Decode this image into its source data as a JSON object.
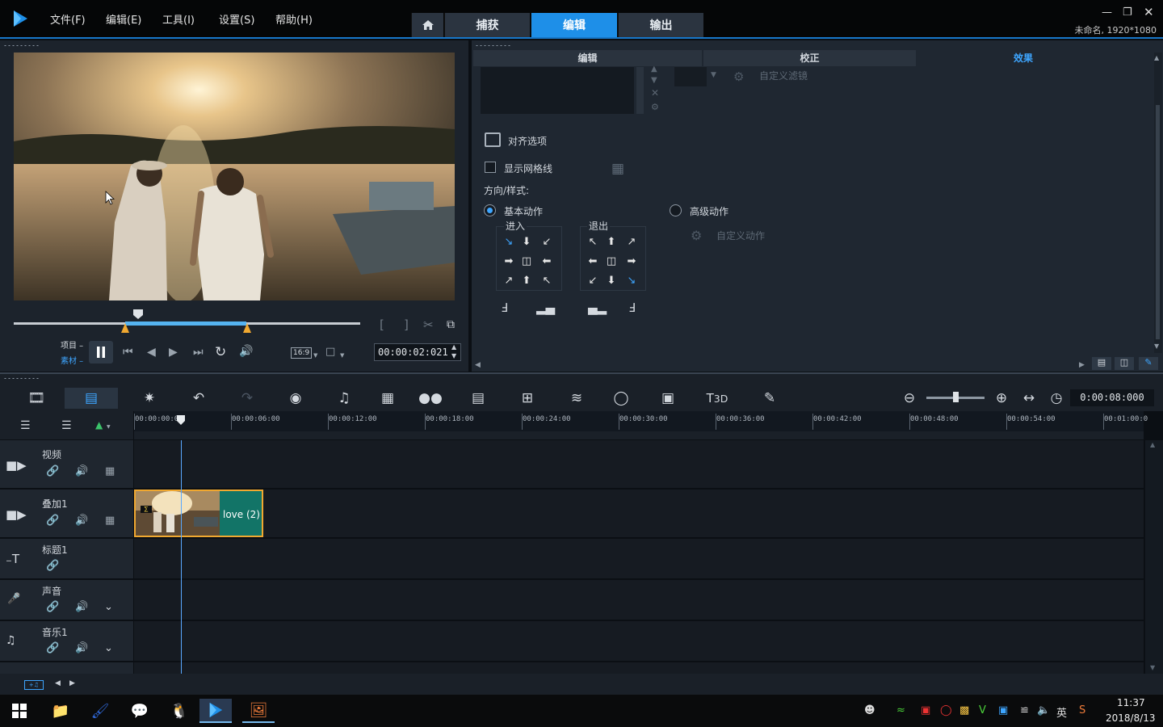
{
  "app": {
    "menu": [
      "文件(F)",
      "编辑(E)",
      "工具(I)",
      "设置(S)",
      "帮助(H)"
    ],
    "nav_tabs": [
      {
        "label": "捕获",
        "active": false
      },
      {
        "label": "编辑",
        "active": true
      },
      {
        "label": "输出",
        "active": false
      }
    ],
    "project_info": "未命名, 1920*1080",
    "accent_color": "#1e8fe8"
  },
  "preview": {
    "timecode": "00:00:02:021",
    "aspect_ratio": "16:9",
    "mode_project": "项目",
    "mode_clip": "素材",
    "slider_position": 0.28
  },
  "options_panel": {
    "tabs": [
      {
        "label": "编辑",
        "active": false
      },
      {
        "label": "校正",
        "active": false
      },
      {
        "label": "效果",
        "active": true
      }
    ],
    "custom_filter_label": "自定义滤镜",
    "alignment_options_label": "对齐选项",
    "show_grid_label": "显示网格线",
    "show_grid_checked": false,
    "direction_style_label": "方向/样式:",
    "basic_motion_label": "基本动作",
    "advanced_motion_label": "高级动作",
    "basic_motion_selected": true,
    "enter_label": "进入",
    "exit_label": "退出",
    "custom_motion_label": "自定义动作"
  },
  "timeline": {
    "duration": "0:00:08:000",
    "ruler_labels": [
      "00:00:00:00",
      "00:00:06:00",
      "00:00:12:00",
      "00:00:18:00",
      "00:00:24:00",
      "00:00:30:00",
      "00:00:36:00",
      "00:00:42:00",
      "00:00:48:00",
      "00:00:54:00",
      "00:01:00:0"
    ],
    "tracks": [
      {
        "name": "视频",
        "type": "video"
      },
      {
        "name": "叠加1",
        "type": "overlay"
      },
      {
        "name": "标题1",
        "type": "title"
      },
      {
        "name": "声音",
        "type": "voice"
      },
      {
        "name": "音乐1",
        "type": "music"
      }
    ],
    "clip": {
      "label": "love (2)",
      "track": "叠加1"
    }
  },
  "taskbar": {
    "time": "11:37",
    "date": "2018/8/13",
    "ime": "英"
  }
}
